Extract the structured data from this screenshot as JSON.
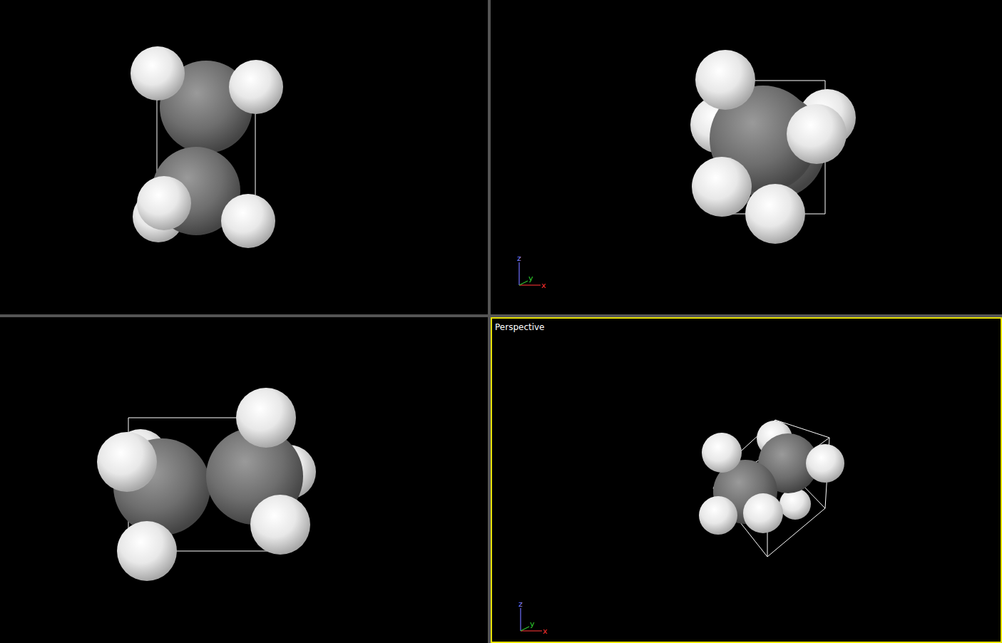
{
  "viewports": [
    {
      "selected": false
    },
    {
      "selected": false,
      "axes": {
        "x": "x",
        "y": "y",
        "z": "z"
      }
    },
    {
      "selected": false
    },
    {
      "label": "Perspective",
      "selected": true,
      "axes": {
        "x": "x",
        "y": "y",
        "z": "z"
      }
    }
  ]
}
